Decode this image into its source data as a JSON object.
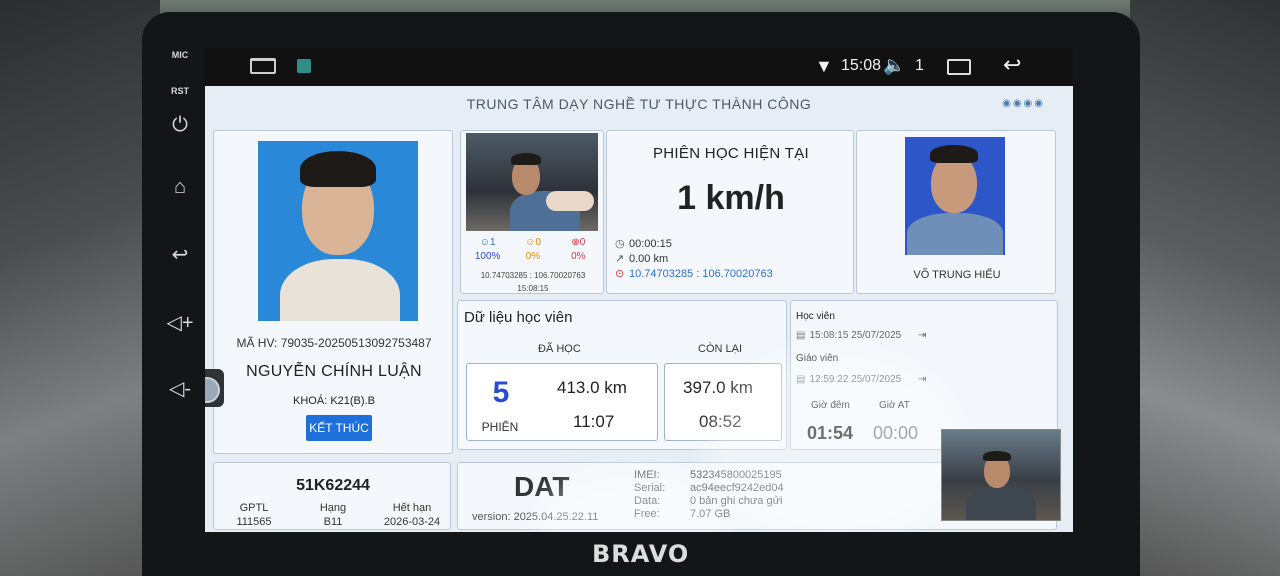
{
  "device_buttons": {
    "mic": "MIC",
    "rst": "RST"
  },
  "statusbar": {
    "time": "15:08",
    "volume_number": "1"
  },
  "header": {
    "title": "TRUNG TÂM DẠY NGHỀ TƯ THỰC THÀNH CÔNG"
  },
  "student": {
    "code": "MÃ HV: 79035-20250513092753487",
    "name": "NGUYỄN CHÍNH LUẬN",
    "course": "KHOÁ: K21(B).B",
    "end_button": "KẾT THÚC"
  },
  "camera": {
    "faces_ok": "1",
    "faces_warn": "0",
    "faces_err": "0",
    "pct_ok": "100%",
    "pct_warn": "0%",
    "pct_err": "0%",
    "coords": "10.74703285 : 106.70020763",
    "time": "15:08:15"
  },
  "session": {
    "title": "PHIÊN HỌC HIỆN TẠI",
    "speed": "1 km/h",
    "duration": "00:00:15",
    "distance": "0.00 km",
    "location": "10.74703285 : 106.70020763"
  },
  "teacher": {
    "name": "VÕ TRUNG HIẾU"
  },
  "student_data": {
    "title": "Dữ liệu học viên",
    "learned_label": "ĐÃ HỌC",
    "remaining_label": "CÒN LẠI",
    "sessions": "5",
    "sessions_label": "PHIÊN",
    "learned_km": "413.0 km",
    "learned_time": "11:07",
    "remaining_km": "397.0 km",
    "remaining_time": "08:52"
  },
  "times": {
    "student_label": "Học viên",
    "student_time": "15:08:15 25/07/2025",
    "teacher_label": "Giáo viên",
    "teacher_time": "12:59:22 25/07/2025",
    "night_label": "Giờ đêm",
    "at_label": "Giờ AT",
    "night_value": "01:54",
    "at_value": "00:00"
  },
  "vehicle": {
    "plate": "51K62244",
    "license_label": "GPTL",
    "license_value": "111565",
    "class_label": "Hạng",
    "class_value": "B11",
    "expiry_label": "Hết hạn",
    "expiry_value": "2026-03-24"
  },
  "device": {
    "brand": "DAT",
    "version": "version: 2025.04.25.22.11",
    "imei_label": "IMEI:",
    "imei_value": "532345800025195",
    "serial_label": "Serial:",
    "serial_value": "ac94eecf9242ed04",
    "data_label": "Data:",
    "data_value": "0 bản ghi chưa gửi",
    "free_label": "Free:",
    "free_value": "7.07 GB"
  },
  "bezel_logo": "BRAVO",
  "colors": {
    "accent": "#1e6fd9",
    "session_count": "#2a4bd0",
    "gps_link": "#2a6fd0",
    "ok_green": "#2b9a3c",
    "warn_orange": "#e08a00",
    "err_red": "#d23a3a"
  }
}
